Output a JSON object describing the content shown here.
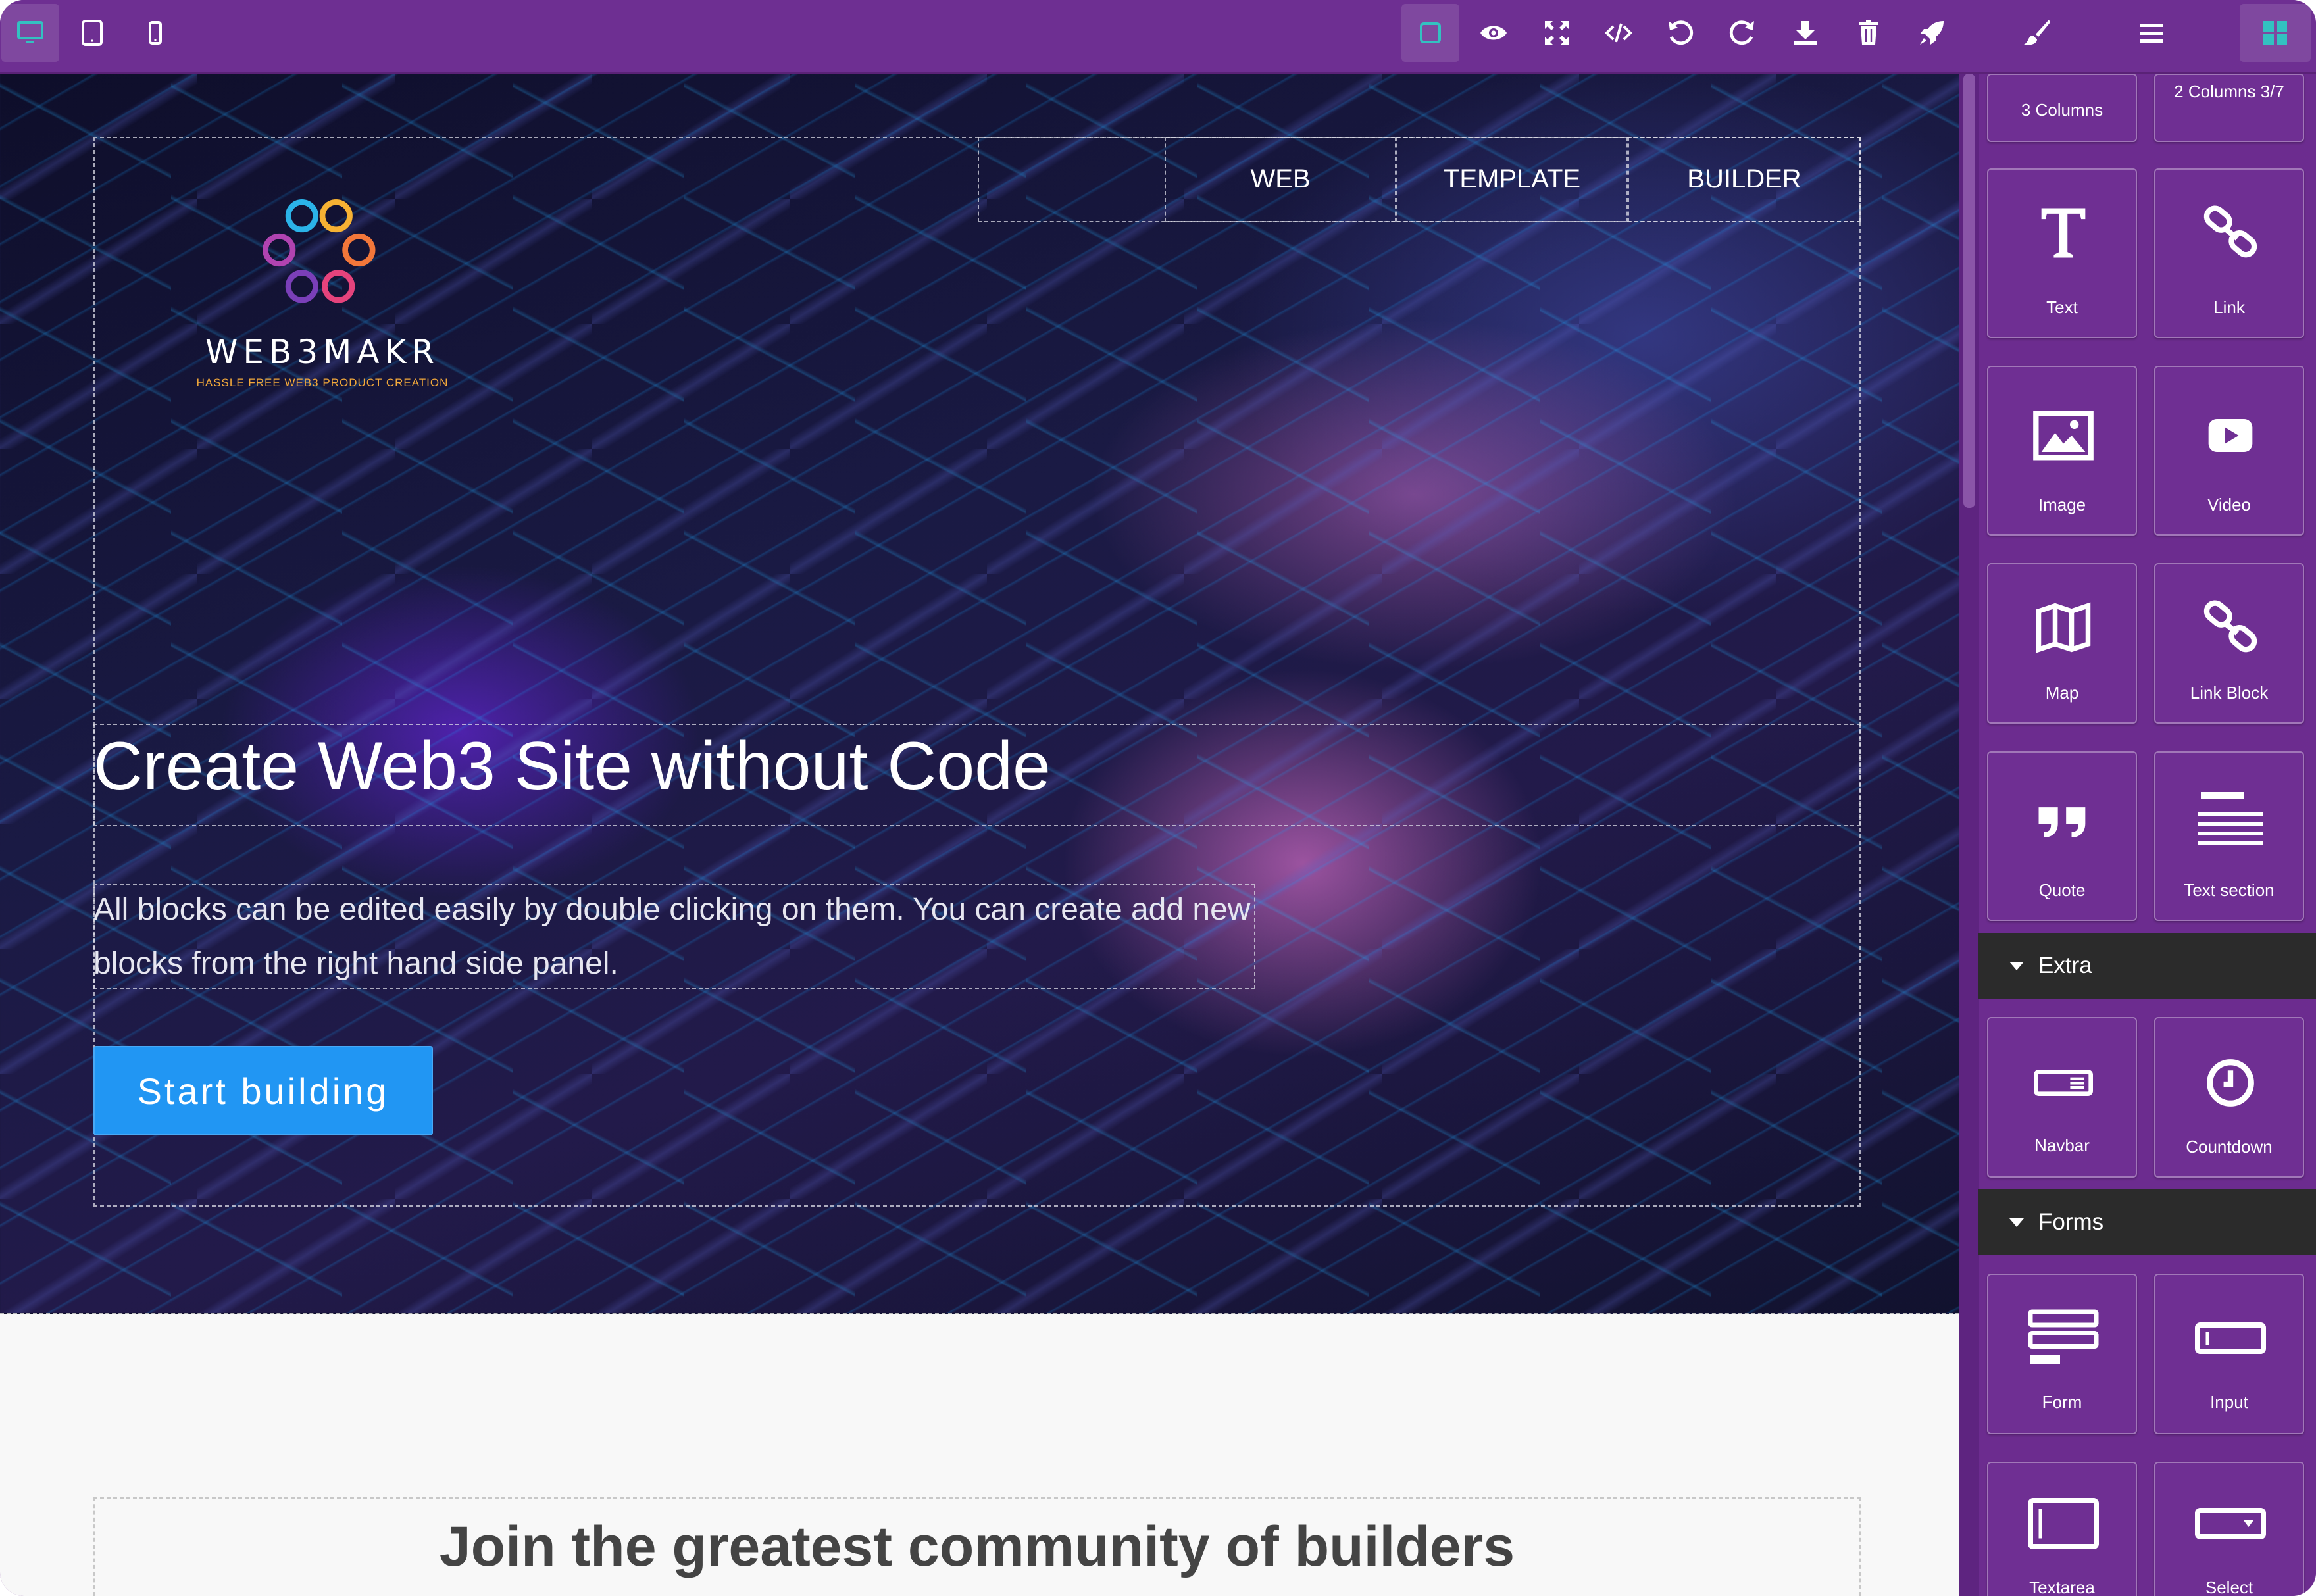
{
  "toolbar": {
    "devices": [
      "desktop-icon",
      "tablet-icon",
      "mobile-icon"
    ],
    "options": [
      "sw-visibility-icon",
      "preview-icon",
      "fullscreen-icon",
      "code-icon",
      "undo-icon",
      "redo-icon",
      "download-icon",
      "trash-icon",
      "publish-icon"
    ],
    "panels": [
      "style-manager-icon",
      "layer-manager-icon",
      "blocks-icon"
    ],
    "accent": "#6e2f92",
    "active_accent": "#2ec4b6"
  },
  "hero": {
    "logo_word": "WEB3MAKR",
    "logo_tagline": "HASSLE FREE WEB3 PRODUCT CREATION",
    "nav": [
      "WEB",
      "TEMPLATE",
      "BUILDER"
    ],
    "title": "Create Web3 Site without Code",
    "text": "All blocks can be edited easily by double clicking on them. You can create add new blocks from the right hand side panel.",
    "cta_label": "Start building",
    "cta_color": "#2196f3"
  },
  "section2": {
    "title": "Join the greatest community of builders"
  },
  "blocks": {
    "top_partial": [
      "3 Columns",
      "2 Columns 3/7"
    ],
    "basic": [
      "Text",
      "Link",
      "Image",
      "Video",
      "Map",
      "Link Block",
      "Quote",
      "Text section"
    ],
    "categories": {
      "extra": "Extra",
      "forms": "Forms"
    },
    "extra": [
      "Navbar",
      "Countdown"
    ],
    "forms": [
      "Form",
      "Input",
      "Textarea",
      "Select"
    ]
  }
}
